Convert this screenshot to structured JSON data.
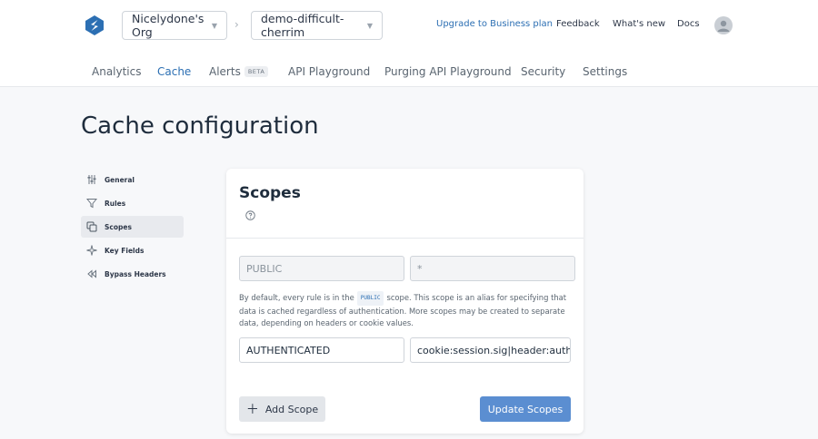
{
  "header": {
    "org_selector": "Nicelydone's Org",
    "project_selector": "demo-difficult-cherrim",
    "links": {
      "upgrade": "Upgrade to Business plan",
      "feedback": "Feedback",
      "whats_new": "What's new",
      "docs": "Docs"
    }
  },
  "tabs": {
    "analytics": "Analytics",
    "cache": "Cache",
    "alerts": "Alerts",
    "alerts_badge": "BETA",
    "api_playground": "API Playground",
    "purging_api_playground": "Purging API Playground",
    "security": "Security",
    "settings": "Settings",
    "active": "Cache"
  },
  "page": {
    "title": "Cache configuration"
  },
  "sidebar": {
    "items": [
      {
        "label": "General",
        "icon": "sliders-icon"
      },
      {
        "label": "Rules",
        "icon": "filter-icon"
      },
      {
        "label": "Scopes",
        "icon": "copy-icon",
        "active": true
      },
      {
        "label": "Key Fields",
        "icon": "sparkle-icon"
      },
      {
        "label": "Bypass Headers",
        "icon": "rewind-icon"
      }
    ]
  },
  "scopes_card": {
    "title": "Scopes",
    "scopes": [
      {
        "name": "PUBLIC",
        "key": "*",
        "disabled": true
      },
      {
        "name": "AUTHENTICATED",
        "key": "cookie:session.sig|header:authorization",
        "disabled": false
      }
    ],
    "description": {
      "before": "By default, every rule is in the",
      "code": "PUBLIC",
      "after": "scope. This scope is an alias for specifying that data is cached regardless of authentication. More scopes may be created to separate data, depending on headers or cookie values."
    },
    "add_button": "Add Scope",
    "update_button": "Update Scopes"
  },
  "colors": {
    "accent": "#2c6fb3",
    "primary_button": "#5b8ed1"
  }
}
